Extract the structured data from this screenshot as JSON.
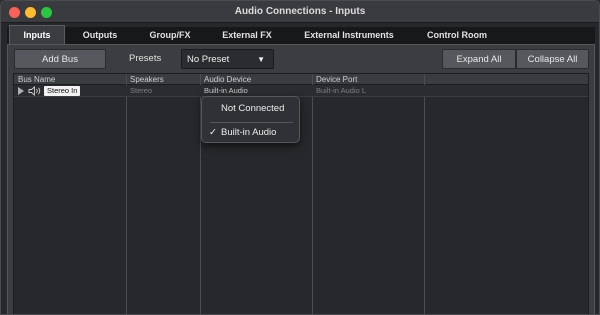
{
  "window": {
    "title": "Audio Connections - Inputs"
  },
  "tabs": [
    {
      "label": "Inputs",
      "active": true
    },
    {
      "label": "Outputs",
      "active": false
    },
    {
      "label": "Group/FX",
      "active": false
    },
    {
      "label": "External FX",
      "active": false
    },
    {
      "label": "External Instruments",
      "active": false
    },
    {
      "label": "Control Room",
      "active": false
    }
  ],
  "toolbar": {
    "add_bus_label": "Add Bus",
    "presets_label": "Presets",
    "preset_value": "No Preset",
    "expand_all_label": "Expand All",
    "collapse_all_label": "Collapse All"
  },
  "table": {
    "columns": [
      "Bus Name",
      "Speakers",
      "Audio Device",
      "Device Port"
    ],
    "rows": [
      {
        "bus_name": "Stereo In",
        "speakers": "Stereo",
        "audio_device": "Built-in Audio",
        "device_port": "Built-in Audio L"
      }
    ]
  },
  "dropdown": {
    "items": [
      {
        "label": "Not Connected",
        "checked": false
      },
      {
        "label": "Built-in Audio",
        "checked": true
      }
    ],
    "check_glyph": "✓"
  },
  "icons": {
    "expand": "triangle-right-icon",
    "speaker": "speaker-icon"
  },
  "colors": {
    "close": "#fe5f57",
    "minimize": "#febc2e",
    "maximize": "#28c840"
  }
}
